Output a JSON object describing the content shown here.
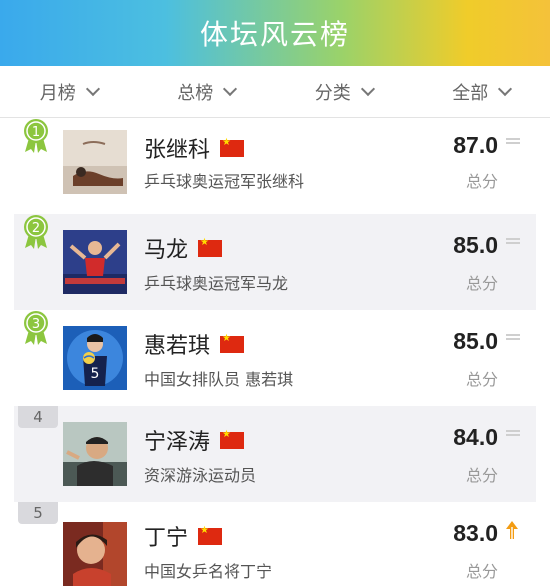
{
  "header": {
    "title": "体坛风云榜"
  },
  "filters": [
    {
      "label": "月榜"
    },
    {
      "label": "总榜"
    },
    {
      "label": "分类"
    },
    {
      "label": "全部"
    }
  ],
  "rows": [
    {
      "rank": "1",
      "name": "张继科",
      "desc": "乒乓球奥运冠军张继科",
      "score": "87.0",
      "score_label": "总分",
      "trend": "flat"
    },
    {
      "rank": "2",
      "name": "马龙",
      "desc": "乒乓球奥运冠军马龙",
      "score": "85.0",
      "score_label": "总分",
      "trend": "flat"
    },
    {
      "rank": "3",
      "name": "惠若琪",
      "desc": "中国女排队员 惠若琪",
      "score": "85.0",
      "score_label": "总分",
      "trend": "flat"
    },
    {
      "rank": "4",
      "name": "宁泽涛",
      "desc": "资深游泳运动员",
      "score": "84.0",
      "score_label": "总分",
      "trend": "flat"
    },
    {
      "rank": "5",
      "name": "丁宁",
      "desc": "中国女乒名将丁宁",
      "score": "83.0",
      "score_label": "总分",
      "trend": "up"
    }
  ],
  "colors": {
    "medal": "#8cc63f",
    "trend_up": "#f39c12",
    "accent_red": "#de2910"
  }
}
